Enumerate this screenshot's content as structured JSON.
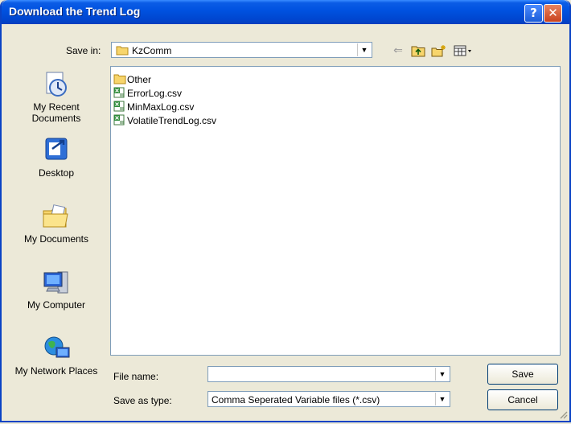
{
  "window": {
    "title": "Download the Trend Log",
    "help_glyph": "?",
    "close_glyph": "✕"
  },
  "toolbar": {
    "save_in_label": "Save in:",
    "save_in_value": "KzComm",
    "back_glyph": "⇐",
    "up_glyph": "⬆",
    "newfolder_glyph": "✱",
    "views_glyph": "▦▾"
  },
  "places": [
    {
      "label": "My Recent Documents",
      "icon": "recent-documents-icon"
    },
    {
      "label": "Desktop",
      "icon": "desktop-icon"
    },
    {
      "label": "My Documents",
      "icon": "my-documents-icon"
    },
    {
      "label": "My Computer",
      "icon": "my-computer-icon"
    },
    {
      "label": "My Network Places",
      "icon": "network-places-icon"
    }
  ],
  "files": [
    {
      "name": "Other",
      "type": "folder"
    },
    {
      "name": "ErrorLog.csv",
      "type": "csv"
    },
    {
      "name": "MinMaxLog.csv",
      "type": "csv"
    },
    {
      "name": "VolatileTrendLog.csv",
      "type": "csv"
    }
  ],
  "form": {
    "file_name_label": "File name:",
    "file_name_value": "",
    "save_as_type_label": "Save as type:",
    "save_as_type_value": "Comma Seperated Variable files (*.csv)"
  },
  "buttons": {
    "save": "Save",
    "cancel": "Cancel"
  },
  "colors": {
    "title_bar": "#0051df",
    "close_button": "#c9421e",
    "frame": "#ece9d8"
  }
}
